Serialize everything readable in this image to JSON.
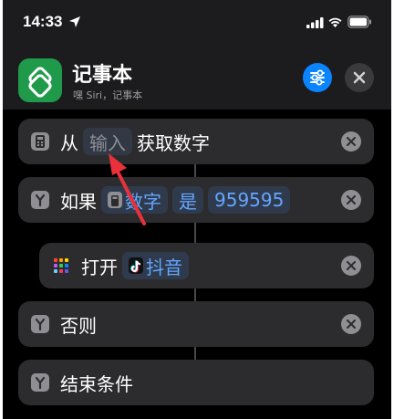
{
  "status_bar": {
    "time": "14:33"
  },
  "header": {
    "app_title": "记事本",
    "app_subtitle": "嘿 Siri，记事本"
  },
  "actions": [
    {
      "prefix": "从",
      "token": "输入",
      "suffix": "获取数字"
    },
    {
      "prefix": "如果",
      "token": "数字",
      "mid": "是",
      "value": "959595"
    },
    {
      "prefix": "打开",
      "token": "抖音"
    },
    {
      "prefix": "否则"
    },
    {
      "prefix": "结束条件"
    }
  ],
  "colors": {
    "accent": "#0a84ff",
    "token_text": "#64a5ff",
    "annotation": "#e8313a"
  },
  "icons": [
    "location-arrow-icon",
    "signal-icon",
    "wifi-icon",
    "battery-icon",
    "shortcuts-app-icon",
    "sliders-icon",
    "close-icon",
    "calculator-icon",
    "branch-icon",
    "app-grid-icon",
    "tiktok-icon",
    "remove-icon"
  ]
}
